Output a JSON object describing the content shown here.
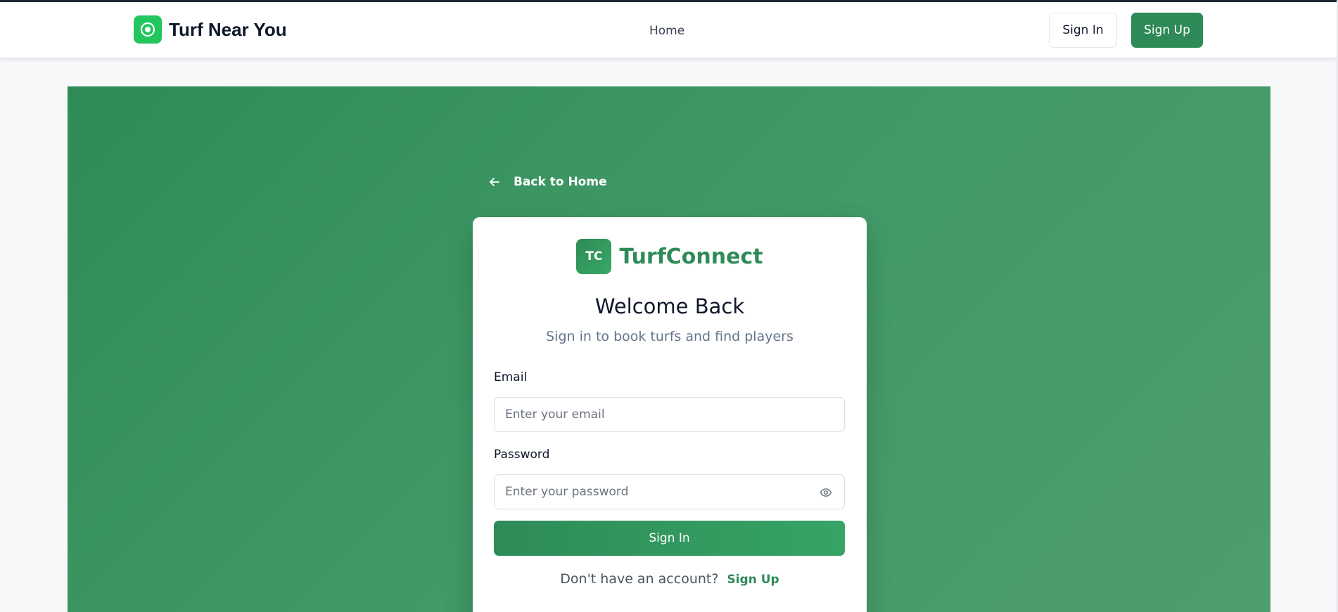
{
  "header": {
    "brand_name": "Turf Near You",
    "nav": {
      "home": "Home"
    },
    "sign_in": "Sign In",
    "sign_up": "Sign Up"
  },
  "back_link": "Back to Home",
  "card": {
    "logo_badge": "TC",
    "logo_text": "TurfConnect",
    "title": "Welcome Back",
    "subtitle": "Sign in to book turfs and find players",
    "email": {
      "label": "Email",
      "placeholder": "Enter your email",
      "value": ""
    },
    "password": {
      "label": "Password",
      "placeholder": "Enter your password",
      "value": ""
    },
    "submit": "Sign In",
    "footer_text": "Don't have an account?",
    "footer_link": "Sign Up"
  },
  "colors": {
    "brand_green": "#2e8b57",
    "brand_icon_green": "#22c55e",
    "hero_gradient_start": "#2e8b57",
    "hero_gradient_end": "#4e9d6f"
  },
  "icons": {
    "brand": "target-icon",
    "back": "arrow-left-icon",
    "password_toggle": "eye-icon"
  }
}
